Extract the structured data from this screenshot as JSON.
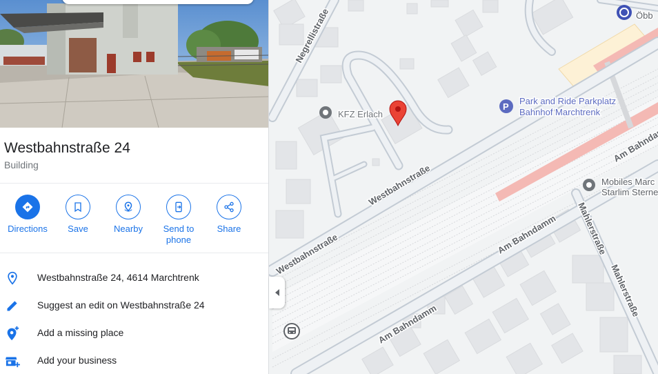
{
  "place": {
    "title": "Westbahnstraße 24",
    "type": "Building"
  },
  "actions": [
    {
      "label": "Directions",
      "icon": "directions-icon"
    },
    {
      "label": "Save",
      "icon": "bookmark-icon"
    },
    {
      "label": "Nearby",
      "icon": "nearby-icon"
    },
    {
      "label": "Send to",
      "label2": "phone",
      "icon": "send-to-phone-icon"
    },
    {
      "label": "Share",
      "icon": "share-icon"
    }
  ],
  "info": [
    {
      "text": "Westbahnstraße 24, 4614 Marchtrenk",
      "icon": "location-pin-icon"
    },
    {
      "text": "Suggest an edit on Westbahnstraße 24",
      "icon": "pencil-icon"
    },
    {
      "text": "Add a missing place",
      "icon": "add-place-icon"
    },
    {
      "text": "Add your business",
      "icon": "add-business-icon"
    }
  ],
  "map": {
    "labels": {
      "negrelli": "Negrellistraße",
      "kfz": "KFZ Erlach",
      "park1": "Park and Ride Parkplatz",
      "park2": "Bahnhof Marchtrenk",
      "westbahn_main": "Westbahnstraße",
      "westbahn_lower": "Westbahnstraße",
      "bahndamm_right": "Am Bahndamm",
      "bahndamm_mid": "Am Bahndamm",
      "bahndamm_lower": "Am Bahndamm",
      "mobiles1": "Mobiles Marc",
      "mobiles2": "Starlim Sterne",
      "mahler1": "Mahlerstraße",
      "mahler2": "Mahlerstraße",
      "obb": "Öbb"
    }
  },
  "colors": {
    "accent": "#1a73e8",
    "pin": "#ea4335",
    "rail": "#f4b9b4",
    "station": "#fdf1d6"
  }
}
